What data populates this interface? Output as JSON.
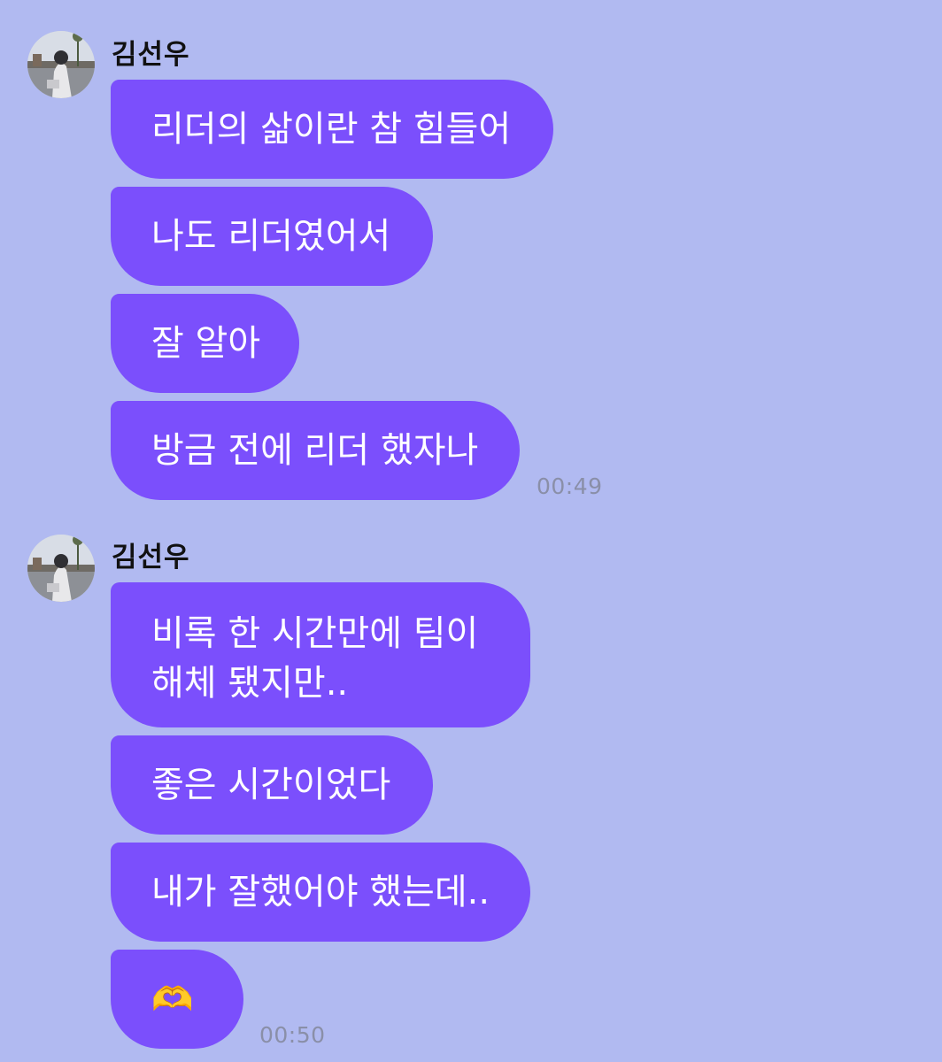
{
  "groups": [
    {
      "sender": "김선우",
      "avatar_icon": "profile-photo",
      "messages": [
        {
          "text": "리더의 삶이란 참 힘들어"
        },
        {
          "text": "나도 리더였어서"
        },
        {
          "text": "잘 알아"
        },
        {
          "text": "방금 전에 리더 했자나"
        }
      ],
      "time": "00:49"
    },
    {
      "sender": "김선우",
      "avatar_icon": "profile-photo",
      "messages": [
        {
          "lines": [
            "비록 한 시간만에 팀이",
            "해체 됐지만.."
          ]
        },
        {
          "text": "좋은 시간이었다"
        },
        {
          "text": "내가 잘했어야 했는데.."
        },
        {
          "text": "🫶"
        }
      ],
      "time": "00:50"
    }
  ],
  "colors": {
    "background": "#b1baf1",
    "bubble": "#7b4ffc",
    "bubble_text": "#ffffff",
    "timestamp": "#8a8fa8"
  }
}
